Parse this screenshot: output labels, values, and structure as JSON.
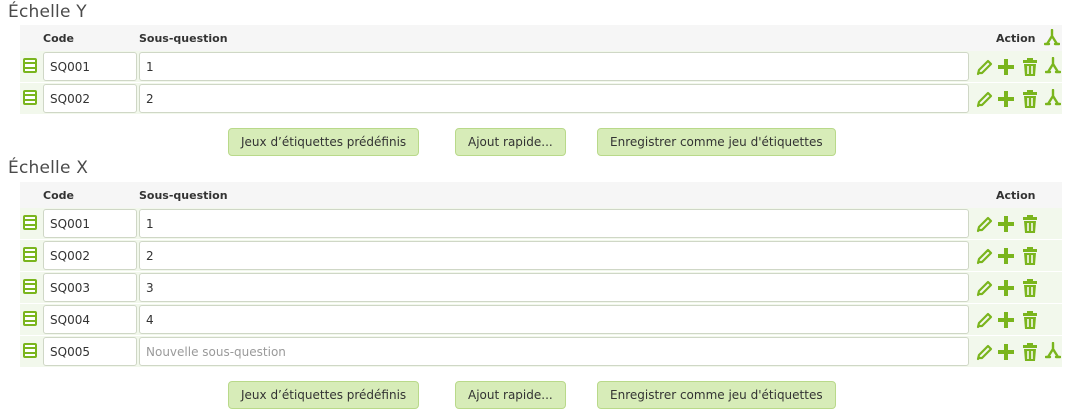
{
  "sections": [
    {
      "title": "Échelle Y",
      "headers": {
        "code": "Code",
        "subquestion": "Sous-question",
        "action": "Action"
      },
      "rows": [
        {
          "code": "SQ001",
          "subquestion": "1",
          "placeholder": ""
        },
        {
          "code": "SQ002",
          "subquestion": "2",
          "placeholder": ""
        }
      ],
      "buttons": {
        "predefined": "Jeux d’étiquettes prédéfinis",
        "quick_add": "Ajout rapide...",
        "save_set": "Enregistrer comme jeu d'étiquettes"
      }
    },
    {
      "title": "Échelle X",
      "headers": {
        "code": "Code",
        "subquestion": "Sous-question",
        "action": "Action"
      },
      "rows": [
        {
          "code": "SQ001",
          "subquestion": "1",
          "placeholder": ""
        },
        {
          "code": "SQ002",
          "subquestion": "2",
          "placeholder": ""
        },
        {
          "code": "SQ003",
          "subquestion": "3",
          "placeholder": ""
        },
        {
          "code": "SQ004",
          "subquestion": "4",
          "placeholder": ""
        },
        {
          "code": "SQ005",
          "subquestion": "",
          "placeholder": "Nouvelle sous-question"
        }
      ],
      "buttons": {
        "predefined": "Jeux d’étiquettes prédéfinis",
        "quick_add": "Ajout rapide...",
        "save_set": "Enregistrer comme jeu d'étiquettes"
      }
    }
  ],
  "icons": {
    "handle": "drag-handle-icon",
    "edit": "pencil-icon",
    "add": "plus-icon",
    "delete": "trash-icon",
    "relevance": "branch-icon"
  },
  "colors": {
    "accent": "#7ab51d",
    "button_bg": "#d7ecb8",
    "row_bg": "#f2f8ec"
  }
}
